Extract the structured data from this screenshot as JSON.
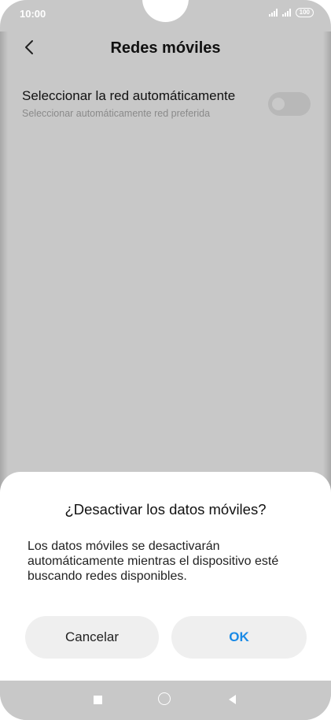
{
  "status_bar": {
    "time": "10:00",
    "battery": "100",
    "icons": [
      "signal-icon",
      "signal-icon",
      "battery-icon"
    ]
  },
  "appbar": {
    "back_icon": "chevron-left-icon",
    "title": "Redes móviles"
  },
  "setting": {
    "title": "Seleccionar la red automáticamente",
    "subtitle": "Seleccionar automáticamente red preferida",
    "toggle_on": false
  },
  "dialog": {
    "title": "¿Desactivar los datos móviles?",
    "message": "Los datos móviles se desactivarán automáticamente mientras el dispositivo esté buscando redes disponibles.",
    "cancel_label": "Cancelar",
    "ok_label": "OK",
    "ok_color": "#1a8ae6"
  },
  "navbar": {
    "icons": [
      "recents-icon",
      "home-icon",
      "back-icon"
    ]
  },
  "colors": {
    "dim_background": "#c8c8c8",
    "dialog_background": "#ffffff",
    "button_background": "#efefef"
  }
}
